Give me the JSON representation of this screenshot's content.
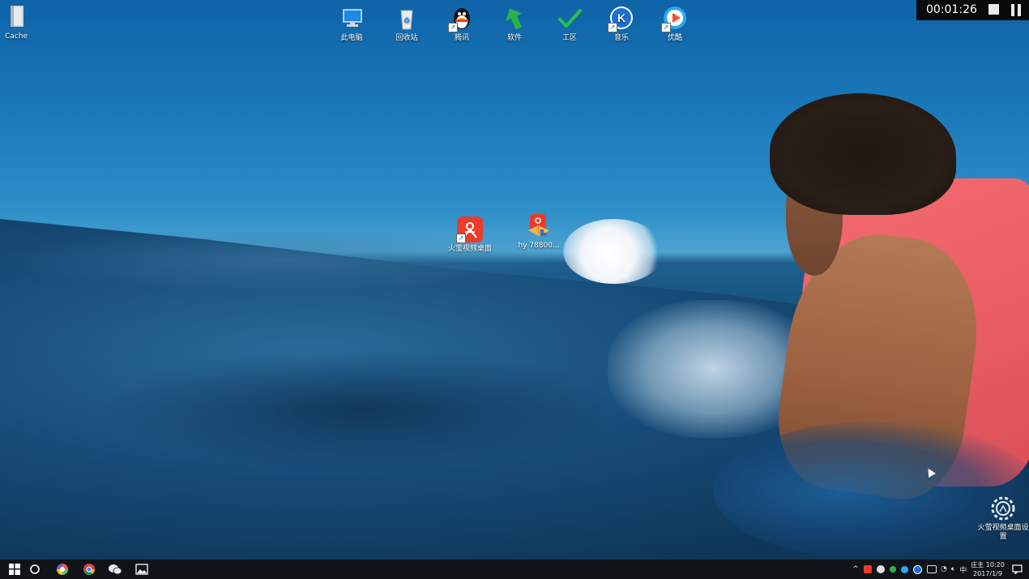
{
  "desktop": {
    "icons": [
      {
        "label": "Cache"
      },
      {
        "label": "此电脑"
      },
      {
        "label": "回收站"
      },
      {
        "label": "腾讯"
      },
      {
        "label": "软件"
      },
      {
        "label": "工区"
      },
      {
        "label": "音乐"
      },
      {
        "label": "优酷"
      },
      {
        "label": "火萤视频桌面"
      },
      {
        "label": "hy 78800..."
      },
      {
        "label": "火萤视频桌面设置"
      }
    ]
  },
  "recorder": {
    "time": "00:01:26"
  },
  "taskbar": {
    "tray_lang": "中",
    "clock_label": "庄主 10:20",
    "clock_date": "2017/1/9"
  },
  "colors": {
    "taskbar": "#101419",
    "recorder_bg": "#0a0a0a",
    "shirt": "#ea5e64"
  }
}
